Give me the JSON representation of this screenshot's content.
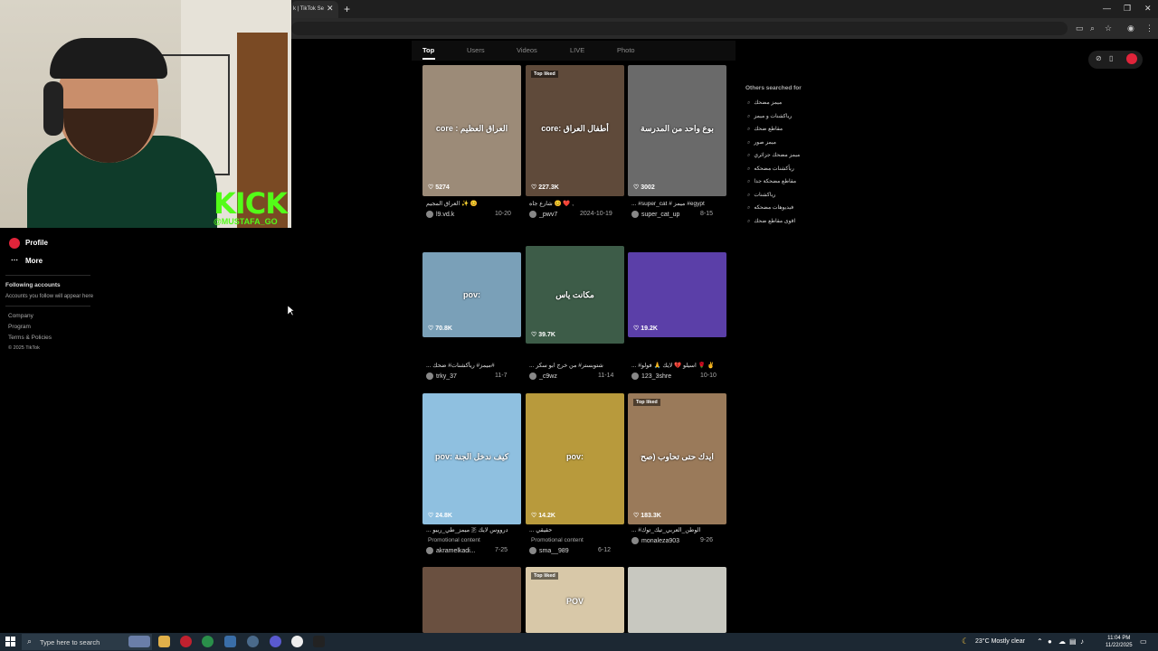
{
  "browser": {
    "tab_title": "k | TikTok Se",
    "close_glyph": "✕",
    "new_tab_glyph": "+",
    "window_controls": [
      "—",
      "❐",
      "✕"
    ],
    "toolbar_icons": [
      "screen-cast-icon",
      "zoom-icon",
      "star-icon",
      "profile-icon",
      "menu-icon"
    ]
  },
  "webcam": {
    "kick_text": "KICK",
    "handle_text": "@MUSTAFA_GO"
  },
  "sidebar": {
    "items": [
      {
        "label": "Profile",
        "icon": "profile-icon",
        "color": "#e0243a"
      },
      {
        "label": "More",
        "icon": "more-icon"
      }
    ],
    "following_title": "Following accounts",
    "following_text": "Accounts you follow will appear here",
    "links": [
      "Company",
      "Program",
      "Terms & Policies",
      "© 2025 TikTok"
    ]
  },
  "main": {
    "tabs": [
      "Top",
      "Users",
      "Videos",
      "LIVE",
      "Photo"
    ],
    "active_tab": "Top",
    "videos": [
      {
        "likes": "5274",
        "overlay": "core : العراق العظيم",
        "caption": "العراق المجيم ✨ 😊",
        "author": "l9.vd.k",
        "date": "10-20",
        "bg": "#9c8b78"
      },
      {
        "likes": "227.3K",
        "overlay": "core: أطفال العراق",
        "top_liked": "Top liked",
        "caption": "شارع جاه 😊 ❤️ ,",
        "author": "_pwv7",
        "date": "2024-10-19",
        "bg": "#5f4a3a"
      },
      {
        "likes": "3002",
        "overlay": "بوع واحد من المدرسة",
        "caption": "... #super_cat # ميمز #egypt",
        "author": "super_cat_up",
        "date": "8-15",
        "bg": "#6a6a6a"
      },
      {
        "likes": "70.8K",
        "overlay": "pov:",
        "caption": "... ميمز# ريأكشنات# ضحك#",
        "author": "trky_37",
        "date": "11-7",
        "bg": "#7aa0b8"
      },
      {
        "likes": "39.7K",
        "overlay": "مكانت ياس",
        "caption": "... شتوبستر# من خرج ابو سكر",
        "author": "_c9wz",
        "date": "11-14",
        "bg": "#3d5c48"
      },
      {
        "likes": "19.2K",
        "overlay": "",
        "caption": "... #اسيلو 💔 لايك 🙏 فولو 🌹 ✌️",
        "author": "123_3shre",
        "date": "10-10",
        "bg": "#5b3fa8"
      },
      {
        "likes": "24.8K",
        "overlay": "pov: كيف ندخل الجنة",
        "caption": "... ميمز_طي_ريبو 🇵 درووس لايك",
        "promo": "Promotional content",
        "author": "akramelkadi...",
        "date": "7-25",
        "bg": "#8fc0e0"
      },
      {
        "likes": "14.2K",
        "overlay": "pov:",
        "caption": "... حقيقي",
        "promo": "Promotional content",
        "author": "sma__989",
        "date": "6-12",
        "bg": "#b89a3c"
      },
      {
        "likes": "183.3K",
        "overlay": "ايدك حتى تحاوب (صح",
        "top_liked": "Top liked",
        "caption": "... #الوطن_العربي_تيك_توك",
        "author": "monaleza903",
        "date": "9-26",
        "bg": "#9a7a5a"
      },
      {
        "likes": "",
        "overlay": "",
        "caption": "",
        "author": "",
        "date": "",
        "bg": "#6a5040"
      },
      {
        "likes": "",
        "overlay": "POV",
        "top_liked": "Top liked",
        "caption": "",
        "author": "",
        "date": "",
        "bg": "#d8c8a8"
      },
      {
        "likes": "",
        "overlay": "",
        "caption": "",
        "author": "",
        "date": "",
        "bg": "#c8c8c0"
      }
    ]
  },
  "right_panel": {
    "title": "Others searched for",
    "searches": [
      "ميمز مضحك",
      "رياكشنات و ميمز",
      "مقاطع ضحك",
      "ميمز صور",
      "ميمز مضحك جزائري",
      "ريأكشنات مضحكه",
      "مقاطع مضحكة جدا",
      "رياكشنات",
      "فيديوهات مضحكه",
      "اقوى مقاطع ضحك"
    ]
  },
  "taskbar": {
    "search_placeholder": "Type here to search",
    "weather": "23°C  Mostly clear",
    "time": "11:04 PM",
    "date": "11/22/2025"
  }
}
